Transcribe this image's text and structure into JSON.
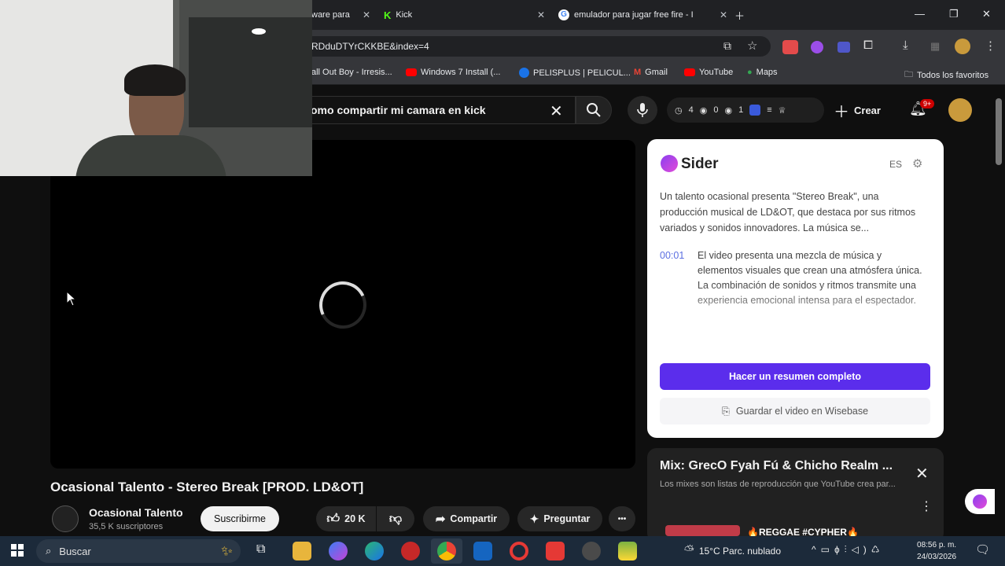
{
  "browser": {
    "tabs": [
      {
        "label": "ware para"
      },
      {
        "label": "Kick"
      },
      {
        "label": "emulador para jugar free fire - I"
      }
    ],
    "url": "RDduDTYrCKKBE&index=4",
    "bookmarks": [
      {
        "label": "all Out Boy - Irresis..."
      },
      {
        "label": "Windows 7 Install (..."
      },
      {
        "label": "PELISPLUS | PELICUL..."
      },
      {
        "label": "Gmail"
      },
      {
        "label": "YouTube"
      },
      {
        "label": "Maps"
      }
    ],
    "all_bookmarks": "Todos los favoritos"
  },
  "youtube": {
    "search_query": "omo compartir mi camara en kick",
    "stats": {
      "views": "4",
      "eye": "0",
      "other": "1"
    },
    "create_label": "Crear",
    "notif_badge": "9+",
    "video": {
      "title": "Ocasional Talento - Stereo Break [PROD. LD&OT]",
      "channel": "Ocasional Talento",
      "subscribers": "35,5 K suscriptores",
      "subscribe_label": "Suscribirme",
      "likes": "20 K",
      "share_label": "Compartir",
      "ask_label": "Preguntar",
      "more_label": "•••"
    },
    "mix": {
      "title": "Mix: GrecO Fyah Fú & Chicho Realm ...",
      "subtitle": "Los mixes son listas de reproducción que YouTube crea par...",
      "item_title": "🔥REGGAE #CYPHER🔥"
    }
  },
  "sider": {
    "title": "Sider",
    "lang": "ES",
    "summary": "Un talento ocasional presenta \"Stereo Break\", una producción musical de LD&OT, que destaca por sus ritmos variados y sonidos innovadores. La música se...",
    "timestamp": "00:01",
    "detail": "El video presenta una mezcla de música y elementos visuales que crean una atmósfera única. La combinación de sonidos y ritmos transmite una experiencia emocional intensa para el espectador.",
    "summary_button": "Hacer un resumen completo",
    "save_button": "Guardar el video en Wisebase"
  },
  "taskbar": {
    "search_label": "Buscar",
    "weather": "15°C  Parc. nublado",
    "time": "08:56 p. m.",
    "date": "24/03/2026"
  },
  "colors": {
    "accent": "#5b2dec",
    "yt_bg": "#0f0f0f",
    "youtube_red": "#ff0000",
    "kick_green": "#53fc18"
  }
}
